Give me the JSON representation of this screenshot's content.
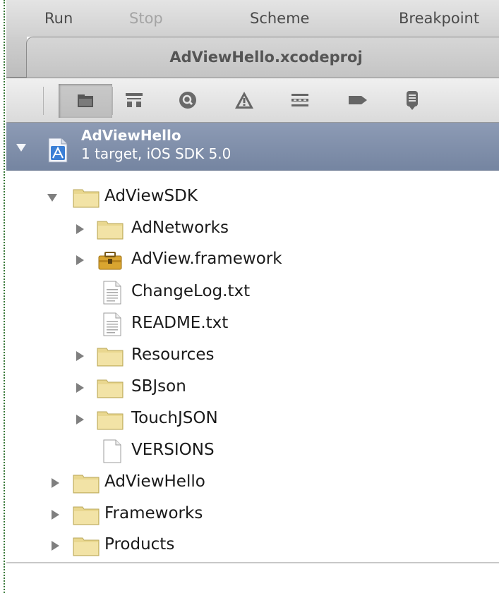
{
  "menu": {
    "run": "Run",
    "stop": "Stop",
    "scheme": "Scheme",
    "breakpoints": "Breakpoint"
  },
  "window": {
    "title": "AdViewHello.xcodeproj"
  },
  "navigator_icons": [
    "folder-icon",
    "hierarchy-icon",
    "search-icon",
    "warning-icon",
    "list-icon",
    "breakpoint-icon",
    "log-icon"
  ],
  "project": {
    "name": "AdViewHello",
    "subtitle": "1 target, iOS SDK 5.0"
  },
  "tree": {
    "adviewsdk": "AdViewSDK",
    "adnetworks": "AdNetworks",
    "adview_framework": "AdView.framework",
    "changelog": "ChangeLog.txt",
    "readme": "README.txt",
    "resources": "Resources",
    "sbjson": "SBJson",
    "touchjson": "TouchJSON",
    "versions": "VERSIONS",
    "adviewhello": "AdViewHello",
    "frameworks": "Frameworks",
    "products": "Products"
  },
  "colors": {
    "selection": "#7f8fab",
    "folder": "#e8d58a",
    "toolbar": "#d8d8d8"
  }
}
